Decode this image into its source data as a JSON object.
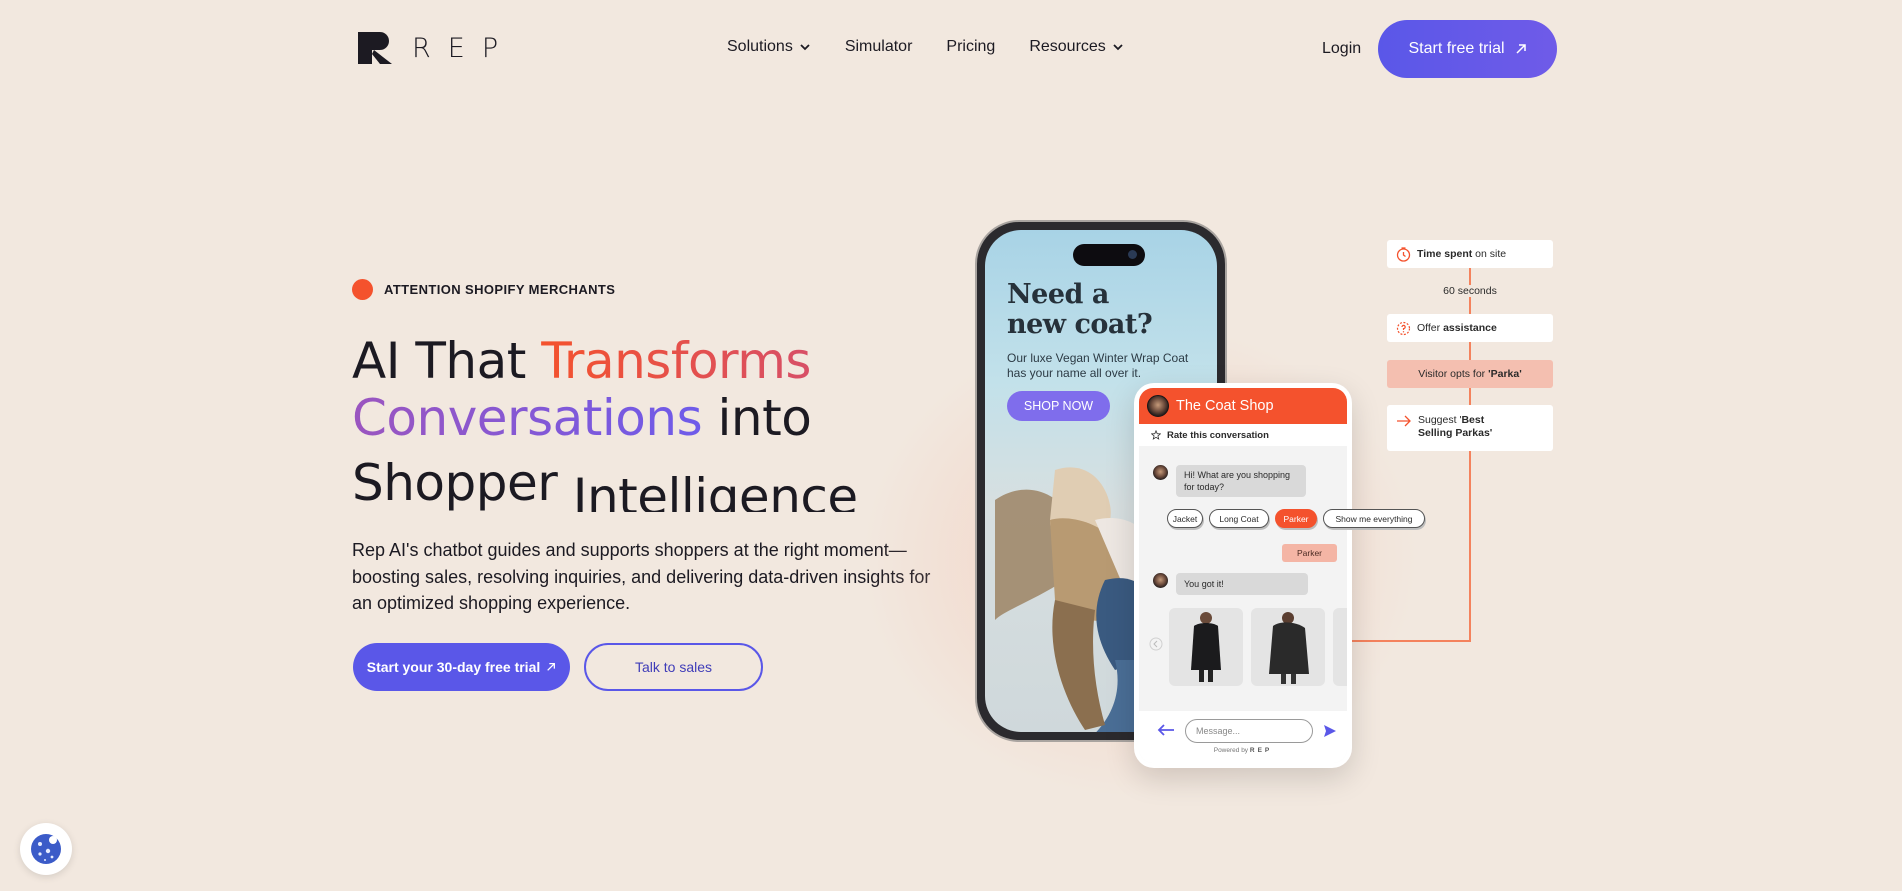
{
  "nav": {
    "logo_text": "REP",
    "links": [
      {
        "label": "Solutions",
        "dropdown": true
      },
      {
        "label": "Simulator",
        "dropdown": false
      },
      {
        "label": "Pricing",
        "dropdown": false
      },
      {
        "label": "Resources",
        "dropdown": true
      }
    ],
    "login": "Login",
    "trial_button": "Start free trial"
  },
  "hero": {
    "badge": "ATTENTION SHOPIFY MERCHANTS",
    "headline": {
      "part1": "AI That ",
      "part2": "Transforms",
      "part3": "Conversations",
      "part4": " into",
      "part5": "Shopper ",
      "part6": "Intelligence"
    },
    "subtext": "Rep AI's chatbot guides and supports shoppers at the right moment—boosting sales, resolving inquiries, and delivering data-driven insights for an optimized shopping experience.",
    "cta_primary": "Start your 30-day free trial",
    "cta_secondary": "Talk to sales"
  },
  "phone_ad": {
    "title_line1": "Need a",
    "title_line2": "new coat?",
    "subtitle": "Our luxe Vegan Winter Wrap Coat has your name all over it.",
    "button": "SHOP NOW"
  },
  "chat": {
    "shop_name": "The Coat Shop",
    "rate_label": "Rate this conversation",
    "bot_msg1": "Hi! What are you shopping for today?",
    "options": [
      "Jacket",
      "Long Coat",
      "Parker",
      "Show me everything"
    ],
    "selected_option": "Parker",
    "user_reply": "Parker",
    "bot_msg2": "You got it!",
    "input_placeholder": "Message...",
    "powered_by": "Powered by",
    "powered_logo": "REP"
  },
  "flow": {
    "step1_bold": "Time spent",
    "step1_rest": " on site",
    "step1_value": "60 seconds",
    "step2_pre": "Offer ",
    "step2_bold": "assistance",
    "step3_pre": "Visitor opts for ",
    "step3_bold": "'Parka'",
    "step4_pre": "Suggest '",
    "step4_bold1": "Best",
    "step4_bold2": "Selling Parkas'",
    "colors": {
      "accent": "#f4522d",
      "primary": "#5a57e8"
    }
  },
  "cookie": {
    "icon": "cookie-icon"
  }
}
